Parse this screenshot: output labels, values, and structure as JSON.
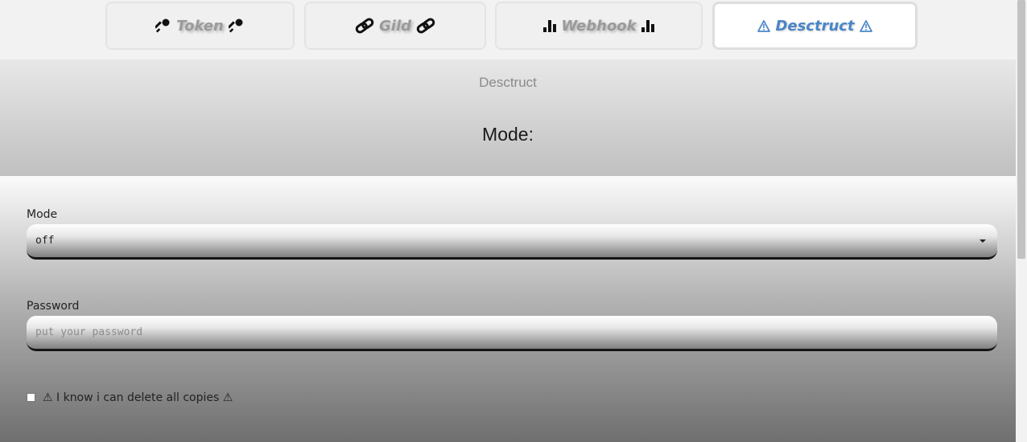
{
  "tabs": [
    {
      "label": "Token",
      "icon": "key-icon",
      "active": false
    },
    {
      "label": "Gild",
      "icon": "link-icon",
      "active": false
    },
    {
      "label": "Webhook",
      "icon": "bar-chart-icon",
      "active": false
    },
    {
      "label": "Desctruct",
      "icon": "warning-icon",
      "active": true
    }
  ],
  "header": {
    "subtitle": "Desctruct",
    "mode_heading": "Mode:"
  },
  "form": {
    "mode_label": "Mode",
    "mode_value": "off",
    "password_label": "Password",
    "password_placeholder": "put your password",
    "confirm_label": "⚠ I know i can delete all copies ⚠"
  },
  "colors": {
    "active_tab_text": "#4a86c8",
    "inactive_tab_text": "#9a9a9a"
  }
}
